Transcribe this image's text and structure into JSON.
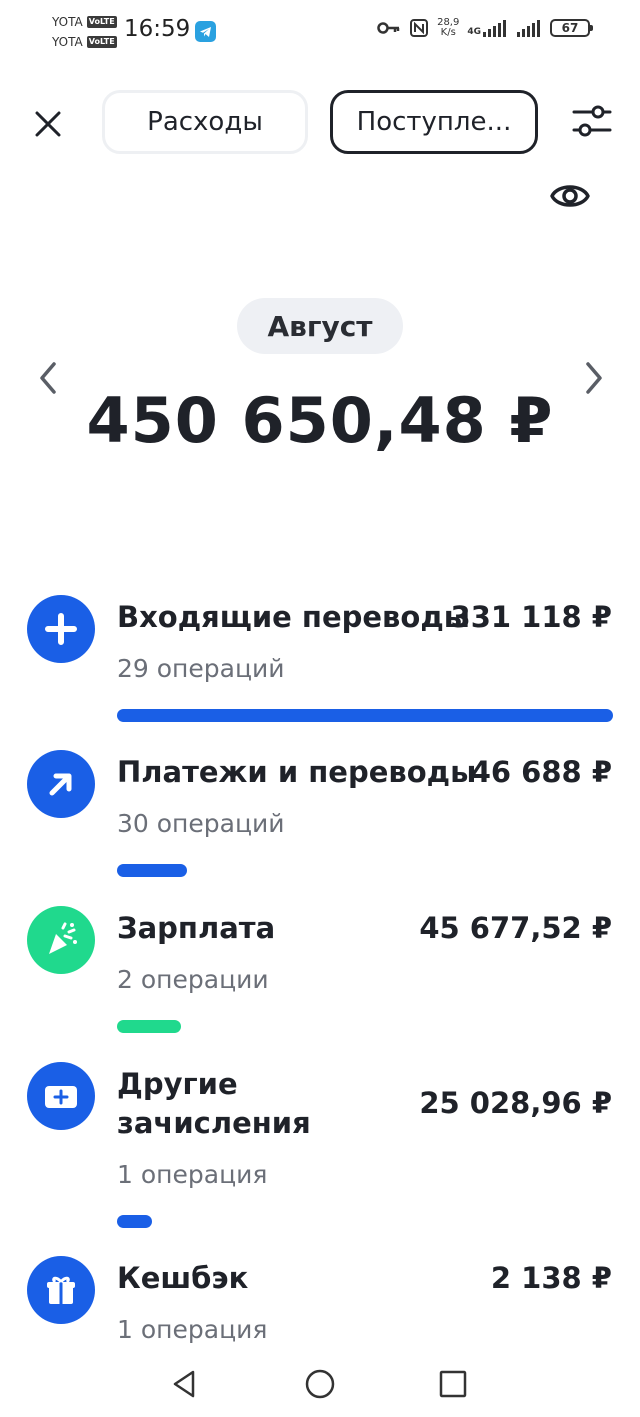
{
  "status": {
    "carrier1": "YOTA",
    "carrier2": "YOTA",
    "volte": "VoLTE",
    "time": "16:59",
    "net_speed_value": "28,9",
    "net_speed_unit": "K/s",
    "net_type": "4G",
    "battery": "67",
    "icons": [
      "telegram-icon",
      "key-icon",
      "nfc-icon",
      "signal-icon",
      "signal-icon",
      "battery-icon"
    ]
  },
  "header": {
    "tabs": [
      {
        "label": "Расходы",
        "active": false
      },
      {
        "label": "Поступле...",
        "active": true
      }
    ],
    "icons": [
      "close-icon",
      "filter-icon",
      "eye-icon"
    ]
  },
  "summary": {
    "month": "Август",
    "total": "450 650,48 ₽",
    "icons": [
      "chevron-left-icon",
      "chevron-right-icon"
    ]
  },
  "categories": [
    {
      "name": "Входящие переводы",
      "amount": "331 118 ₽",
      "count": "29 операций",
      "icon": "plus-icon",
      "color": "#1a5fe6",
      "share": 1.0
    },
    {
      "name": "Платежи и переводы",
      "amount": "46 688 ₽",
      "count": "30 операций",
      "icon": "arrow-up-right-icon",
      "color": "#1a5fe6",
      "share": 0.141
    },
    {
      "name": "Зарплата",
      "amount": "45 677,52 ₽",
      "count": "2 операции",
      "icon": "party-popper-icon",
      "color": "#20d98d",
      "share": 0.13
    },
    {
      "name": "Другие зачисления",
      "name_line1": "Другие",
      "name_line2": "зачисления",
      "amount": "25 028,96 ₽",
      "count": "1 операция",
      "icon": "wallet-plus-icon",
      "color": "#1a5fe6",
      "share": 0.07
    },
    {
      "name": "Кешбэк",
      "amount": "2 138 ₽",
      "count": "1 операция",
      "icon": "gift-icon",
      "color": "#1a5fe6",
      "share": null
    }
  ],
  "nav": {
    "icons": [
      "back-triangle-icon",
      "home-circle-icon",
      "recents-square-icon"
    ]
  }
}
